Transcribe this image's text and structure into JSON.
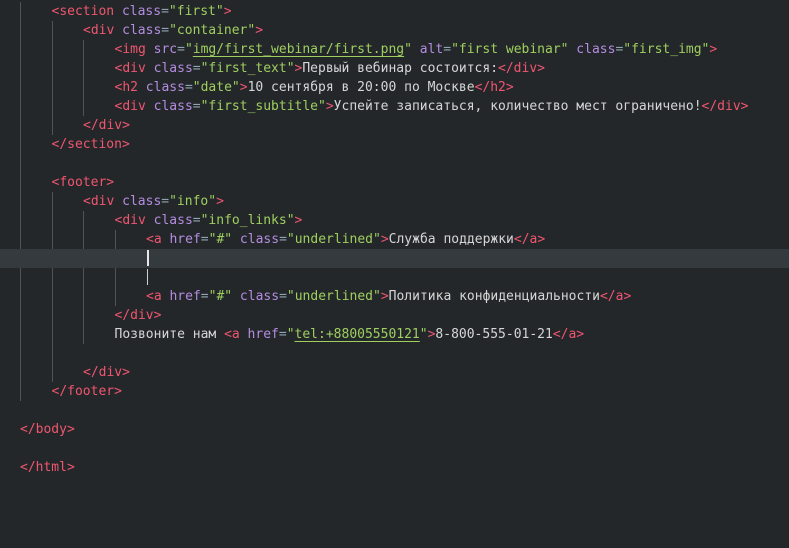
{
  "editor": {
    "colors": {
      "background": "#23272a",
      "active_line": "#353a3e",
      "tag": "#f0566f",
      "attribute": "#b48ce0",
      "string": "#9fcf5f",
      "punctuation": "#8fa4b3",
      "text": "#d6d6d6"
    },
    "active_line_index": 13,
    "lines": [
      {
        "indent": 1,
        "tokens": [
          [
            "tag",
            "<section"
          ],
          [
            "attr",
            " class"
          ],
          [
            "pun",
            "="
          ],
          [
            "str",
            "\"first\""
          ],
          [
            "tag",
            ">"
          ]
        ]
      },
      {
        "indent": 2,
        "tokens": [
          [
            "tag",
            "<div"
          ],
          [
            "attr",
            " class"
          ],
          [
            "pun",
            "="
          ],
          [
            "str",
            "\"container\""
          ],
          [
            "tag",
            ">"
          ]
        ]
      },
      {
        "indent": 3,
        "tokens": [
          [
            "tag",
            "<img"
          ],
          [
            "attr",
            " src"
          ],
          [
            "pun",
            "="
          ],
          [
            "str",
            "\""
          ],
          [
            "strul",
            "img/first_webinar/first.png"
          ],
          [
            "str",
            "\""
          ],
          [
            "attr",
            " alt"
          ],
          [
            "pun",
            "="
          ],
          [
            "str",
            "\"first webinar\""
          ],
          [
            "attr",
            " class"
          ],
          [
            "pun",
            "="
          ],
          [
            "str",
            "\"first_img\""
          ],
          [
            "tag",
            ">"
          ]
        ]
      },
      {
        "indent": 3,
        "tokens": [
          [
            "tag",
            "<div"
          ],
          [
            "attr",
            " class"
          ],
          [
            "pun",
            "="
          ],
          [
            "str",
            "\"first_text\""
          ],
          [
            "tag",
            ">"
          ],
          [
            "text",
            "Первый вебинар состоится:"
          ],
          [
            "tag",
            "</div>"
          ]
        ]
      },
      {
        "indent": 3,
        "tokens": [
          [
            "tag",
            "<h2"
          ],
          [
            "attr",
            " class"
          ],
          [
            "pun",
            "="
          ],
          [
            "str",
            "\"date\""
          ],
          [
            "tag",
            ">"
          ],
          [
            "text",
            "10 сентября в 20:00 по Москве"
          ],
          [
            "tag",
            "</h2>"
          ]
        ]
      },
      {
        "indent": 3,
        "tokens": [
          [
            "tag",
            "<div"
          ],
          [
            "attr",
            " class"
          ],
          [
            "pun",
            "="
          ],
          [
            "str",
            "\"first_subtitle\""
          ],
          [
            "tag",
            ">"
          ],
          [
            "text",
            "Успейте записаться, количество мест ограничено!"
          ],
          [
            "tag",
            "</div>"
          ]
        ]
      },
      {
        "indent": 2,
        "tokens": [
          [
            "tag",
            "</div>"
          ]
        ]
      },
      {
        "indent": 1,
        "tokens": [
          [
            "tag",
            "</section>"
          ]
        ]
      },
      {
        "indent": 0,
        "tokens": []
      },
      {
        "indent": 1,
        "tokens": [
          [
            "tag",
            "<footer>"
          ]
        ]
      },
      {
        "indent": 2,
        "tokens": [
          [
            "tag",
            "<div"
          ],
          [
            "attr",
            " class"
          ],
          [
            "pun",
            "="
          ],
          [
            "str",
            "\"info\""
          ],
          [
            "tag",
            ">"
          ]
        ]
      },
      {
        "indent": 3,
        "tokens": [
          [
            "tag",
            "<div"
          ],
          [
            "attr",
            " class"
          ],
          [
            "pun",
            "="
          ],
          [
            "str",
            "\"info_links\""
          ],
          [
            "tag",
            ">"
          ]
        ]
      },
      {
        "indent": 4,
        "tokens": [
          [
            "tag",
            "<a"
          ],
          [
            "attr",
            " href"
          ],
          [
            "pun",
            "="
          ],
          [
            "str",
            "\"#\""
          ],
          [
            "attr",
            " class"
          ],
          [
            "pun",
            "="
          ],
          [
            "str",
            "\"underlined\""
          ],
          [
            "tag",
            ">"
          ],
          [
            "text",
            "Служба поддержки"
          ],
          [
            "tag",
            "</a>"
          ]
        ]
      },
      {
        "indent": 4,
        "tokens": []
      },
      {
        "indent": 4,
        "tokens": []
      },
      {
        "indent": 4,
        "tokens": [
          [
            "tag",
            "<a"
          ],
          [
            "attr",
            " href"
          ],
          [
            "pun",
            "="
          ],
          [
            "str",
            "\"#\""
          ],
          [
            "attr",
            " class"
          ],
          [
            "pun",
            "="
          ],
          [
            "str",
            "\"underlined\""
          ],
          [
            "tag",
            ">"
          ],
          [
            "text",
            "Политика конфиденциальности"
          ],
          [
            "tag",
            "</a>"
          ]
        ]
      },
      {
        "indent": 3,
        "tokens": [
          [
            "tag",
            "</div>"
          ]
        ]
      },
      {
        "indent": 3,
        "tokens": [
          [
            "text",
            "Позвоните нам "
          ],
          [
            "tag",
            "<a"
          ],
          [
            "attr",
            " href"
          ],
          [
            "pun",
            "="
          ],
          [
            "str",
            "\""
          ],
          [
            "strul",
            "tel:+88005550121"
          ],
          [
            "str",
            "\""
          ],
          [
            "tag",
            ">"
          ],
          [
            "text",
            "8-800-555-01-21"
          ],
          [
            "tag",
            "</a>"
          ]
        ]
      },
      {
        "indent": 0,
        "tokens": []
      },
      {
        "indent": 2,
        "tokens": [
          [
            "tag",
            "</div>"
          ]
        ]
      },
      {
        "indent": 1,
        "tokens": [
          [
            "tag",
            "</footer>"
          ]
        ]
      },
      {
        "indent": 0,
        "tokens": []
      },
      {
        "indent": 0,
        "tokens": [
          [
            "tag",
            "</body>"
          ]
        ]
      },
      {
        "indent": 0,
        "tokens": []
      },
      {
        "indent": 0,
        "tokens": [
          [
            "tag",
            "</html>"
          ]
        ]
      }
    ]
  }
}
